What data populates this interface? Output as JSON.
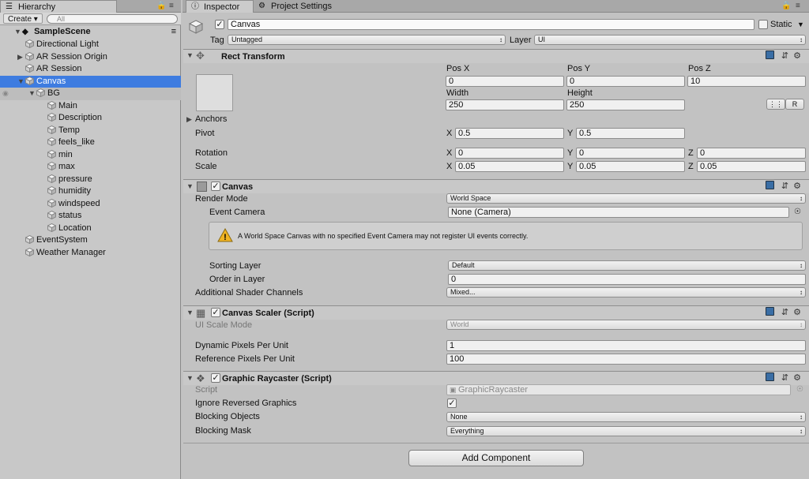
{
  "hierarchy": {
    "tab": "Hierarchy",
    "create": "Create",
    "search_placeholder": "All",
    "scene": "SampleScene",
    "items": [
      {
        "label": "Directional Light"
      },
      {
        "label": "AR Session Origin"
      },
      {
        "label": "AR Session"
      },
      {
        "label": "Canvas"
      },
      {
        "label": "BG"
      },
      {
        "label": "Main"
      },
      {
        "label": "Description"
      },
      {
        "label": "Temp"
      },
      {
        "label": "feels_like"
      },
      {
        "label": "min"
      },
      {
        "label": "max"
      },
      {
        "label": "pressure"
      },
      {
        "label": "humidity"
      },
      {
        "label": "windspeed"
      },
      {
        "label": "status"
      },
      {
        "label": "Location"
      },
      {
        "label": "EventSystem"
      },
      {
        "label": "Weather Manager"
      }
    ]
  },
  "tabs": {
    "inspector": "Inspector",
    "project_settings": "Project Settings"
  },
  "object": {
    "name": "Canvas",
    "static": "Static",
    "tag_label": "Tag",
    "tag": "Untagged",
    "layer_label": "Layer",
    "layer": "UI"
  },
  "rect": {
    "title": "Rect Transform",
    "posx_label": "Pos X",
    "posy_label": "Pos Y",
    "posz_label": "Pos Z",
    "posx": "0",
    "posy": "0",
    "posz": "10",
    "width_label": "Width",
    "height_label": "Height",
    "width": "250",
    "height": "250",
    "r_btn": "R",
    "anchors": "Anchors",
    "pivot": "Pivot",
    "pivot_x": "0.5",
    "pivot_y": "0.5",
    "rotation": "Rotation",
    "rot_x": "0",
    "rot_y": "0",
    "rot_z": "0",
    "scale": "Scale",
    "scale_x": "0.05",
    "scale_y": "0.05",
    "scale_z": "0.05",
    "x": "X",
    "y": "Y",
    "z": "Z"
  },
  "canvas": {
    "title": "Canvas",
    "render_mode_label": "Render Mode",
    "render_mode": "World Space",
    "event_camera_label": "Event Camera",
    "event_camera": "None (Camera)",
    "warning": "A World Space Canvas with no specified Event Camera may not register UI events correctly.",
    "sorting_layer_label": "Sorting Layer",
    "sorting_layer": "Default",
    "order_label": "Order in Layer",
    "order": "0",
    "shader_label": "Additional Shader Channels",
    "shader": "Mixed..."
  },
  "scaler": {
    "title": "Canvas Scaler (Script)",
    "ui_scale_label": "UI Scale Mode",
    "ui_scale": "World",
    "dpp_label": "Dynamic Pixels Per Unit",
    "dpp": "1",
    "rpp_label": "Reference Pixels Per Unit",
    "rpp": "100"
  },
  "raycaster": {
    "title": "Graphic Raycaster (Script)",
    "script_label": "Script",
    "script": "GraphicRaycaster",
    "ignore_label": "Ignore Reversed Graphics",
    "blocking_label": "Blocking Objects",
    "blocking": "None",
    "mask_label": "Blocking Mask",
    "mask": "Everything"
  },
  "add_component": "Add Component"
}
